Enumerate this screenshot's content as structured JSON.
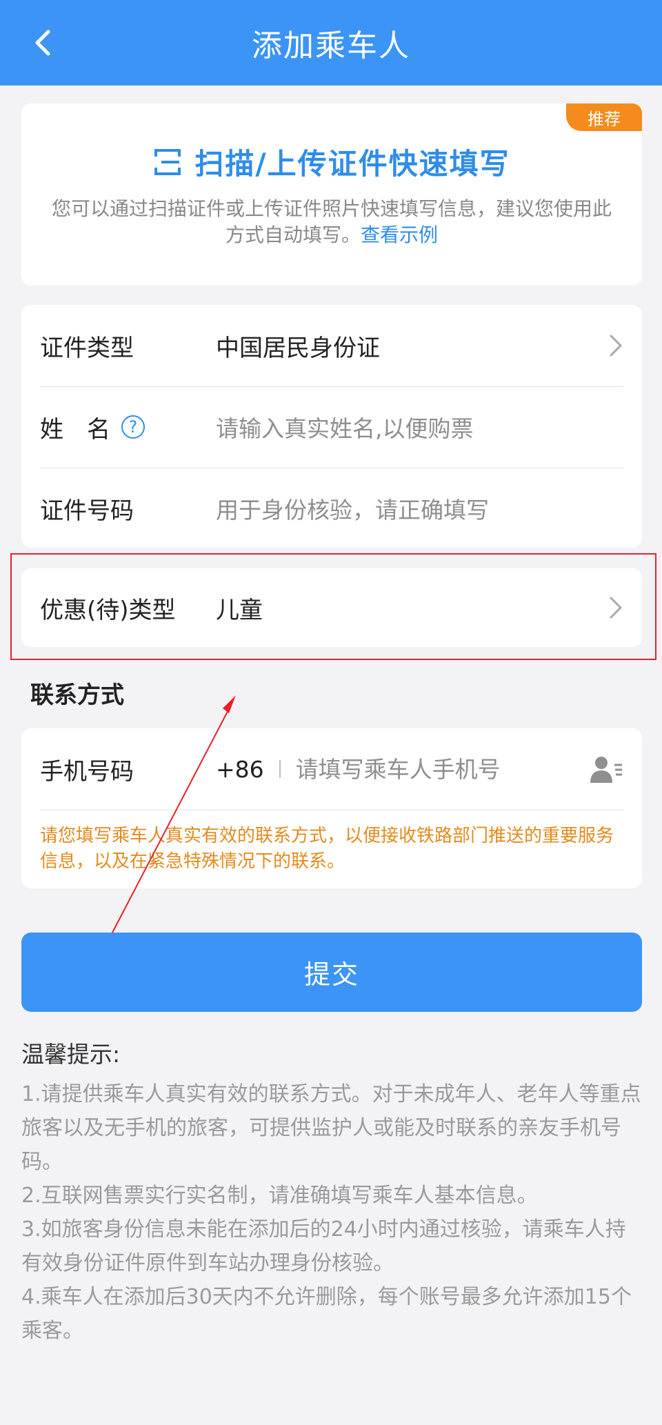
{
  "header": {
    "title": "添加乘车人"
  },
  "scan": {
    "badge": "推荐",
    "title": "扫描/上传证件快速填写",
    "desc": "您可以通过扫描证件或上传证件照片快速填写信息，建议您使用此方式自动填写。",
    "link": "查看示例"
  },
  "form": {
    "id_type_label": "证件类型",
    "id_type_value": "中国居民身份证",
    "name_label": "姓　名",
    "name_placeholder": "请输入真实姓名,以便购票",
    "id_number_label": "证件号码",
    "id_number_placeholder": "用于身份核验，请正确填写"
  },
  "discount": {
    "label": "优惠(待)类型",
    "value": "儿童"
  },
  "contact": {
    "section_title": "联系方式",
    "phone_label": "手机号码",
    "country_code": "+86",
    "phone_placeholder": "请填写乘车人手机号",
    "notice": "请您填写乘车人真实有效的联系方式，以便接收铁路部门推送的重要服务信息，以及在紧急特殊情况下的联系。"
  },
  "submit_label": "提交",
  "tips": {
    "title": "温馨提示:",
    "items": [
      "1.请提供乘车人真实有效的联系方式。对于未成年人、老年人等重点旅客以及无手机的旅客，可提供监护人或能及时联系的亲友手机号码。",
      "2.互联网售票实行实名制，请准确填写乘车人基本信息。",
      "3.如旅客身份信息未能在添加后的24小时内通过核验，请乘车人持有效身份证件原件到车站办理身份核验。",
      "4.乘车人在添加后30天内不允许删除，每个账号最多允许添加15个乘客。"
    ]
  },
  "colors": {
    "primary": "#3b94f6",
    "badge": "#f48b1c",
    "link": "#2f8de8",
    "notice": "#e38a1d",
    "annotation": "#e8202a"
  }
}
